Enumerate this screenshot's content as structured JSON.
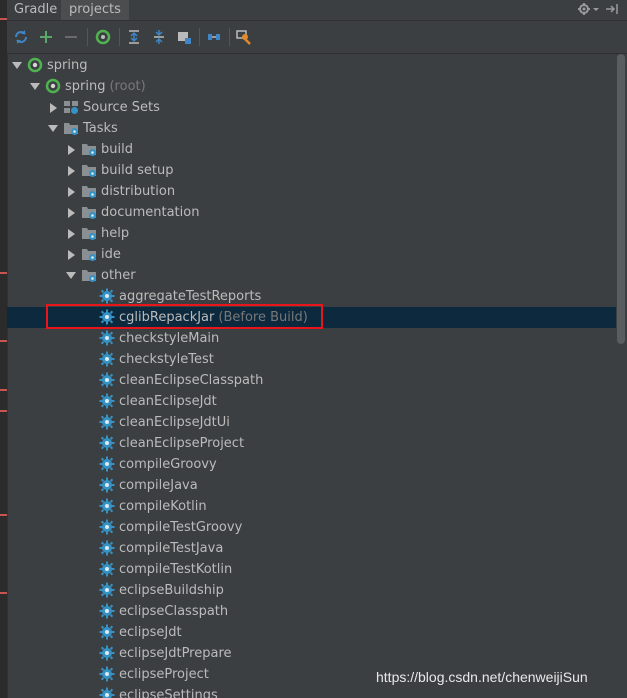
{
  "window": {
    "tabs": [
      "Gradle",
      "projects"
    ]
  },
  "toolbar": {
    "buttons": [
      {
        "name": "refresh-icon",
        "tooltip": ""
      },
      {
        "name": "add-icon"
      },
      {
        "name": "remove-icon"
      },
      {
        "name": "gradle-task-icon"
      },
      {
        "name": "expand-all-icon"
      },
      {
        "name": "collapse-all-icon"
      },
      {
        "name": "offline-mode-icon"
      },
      {
        "name": "dependencies-icon"
      },
      {
        "name": "settings-wrench-icon"
      }
    ]
  },
  "tree": {
    "selected_index": 12,
    "rows": [
      {
        "label": "spring",
        "hint": "",
        "level": 0,
        "expanded": true,
        "kind": "project"
      },
      {
        "label": "spring",
        "hint": "(root)",
        "level": 1,
        "expanded": true,
        "kind": "project"
      },
      {
        "label": "Source Sets",
        "hint": "",
        "level": 2,
        "expanded": false,
        "kind": "sourcesets"
      },
      {
        "label": "Tasks",
        "hint": "",
        "level": 2,
        "expanded": true,
        "kind": "folder"
      },
      {
        "label": "build",
        "hint": "",
        "level": 3,
        "expanded": false,
        "kind": "folder"
      },
      {
        "label": "build setup",
        "hint": "",
        "level": 3,
        "expanded": false,
        "kind": "folder"
      },
      {
        "label": "distribution",
        "hint": "",
        "level": 3,
        "expanded": false,
        "kind": "folder"
      },
      {
        "label": "documentation",
        "hint": "",
        "level": 3,
        "expanded": false,
        "kind": "folder"
      },
      {
        "label": "help",
        "hint": "",
        "level": 3,
        "expanded": false,
        "kind": "folder"
      },
      {
        "label": "ide",
        "hint": "",
        "level": 3,
        "expanded": false,
        "kind": "folder"
      },
      {
        "label": "other",
        "hint": "",
        "level": 3,
        "expanded": true,
        "kind": "folder"
      },
      {
        "label": "aggregateTestReports",
        "hint": "",
        "level": 4,
        "kind": "task"
      },
      {
        "label": "cglibRepackJar",
        "hint": "(Before Build)",
        "level": 4,
        "kind": "task"
      },
      {
        "label": "checkstyleMain",
        "hint": "",
        "level": 4,
        "kind": "task"
      },
      {
        "label": "checkstyleTest",
        "hint": "",
        "level": 4,
        "kind": "task"
      },
      {
        "label": "cleanEclipseClasspath",
        "hint": "",
        "level": 4,
        "kind": "task"
      },
      {
        "label": "cleanEclipseJdt",
        "hint": "",
        "level": 4,
        "kind": "task"
      },
      {
        "label": "cleanEclipseJdtUi",
        "hint": "",
        "level": 4,
        "kind": "task"
      },
      {
        "label": "cleanEclipseProject",
        "hint": "",
        "level": 4,
        "kind": "task"
      },
      {
        "label": "compileGroovy",
        "hint": "",
        "level": 4,
        "kind": "task"
      },
      {
        "label": "compileJava",
        "hint": "",
        "level": 4,
        "kind": "task"
      },
      {
        "label": "compileKotlin",
        "hint": "",
        "level": 4,
        "kind": "task"
      },
      {
        "label": "compileTestGroovy",
        "hint": "",
        "level": 4,
        "kind": "task"
      },
      {
        "label": "compileTestJava",
        "hint": "",
        "level": 4,
        "kind": "task"
      },
      {
        "label": "compileTestKotlin",
        "hint": "",
        "level": 4,
        "kind": "task"
      },
      {
        "label": "eclipseBuildship",
        "hint": "",
        "level": 4,
        "kind": "task"
      },
      {
        "label": "eclipseClasspath",
        "hint": "",
        "level": 4,
        "kind": "task"
      },
      {
        "label": "eclipseJdt",
        "hint": "",
        "level": 4,
        "kind": "task"
      },
      {
        "label": "eclipseJdtPrepare",
        "hint": "",
        "level": 4,
        "kind": "task"
      },
      {
        "label": "eclipseProject",
        "hint": "",
        "level": 4,
        "kind": "task"
      },
      {
        "label": "eclipseSettings",
        "hint": "",
        "level": 4,
        "kind": "task"
      }
    ]
  },
  "colors": {
    "background": "#3c3f41",
    "selection": "#0d293e",
    "task_gear": "#3592c4",
    "gradle_green": "#4fb34f",
    "highlight_box": "#e8161b"
  },
  "watermark": "https://blog.csdn.net/chenweijiSun"
}
